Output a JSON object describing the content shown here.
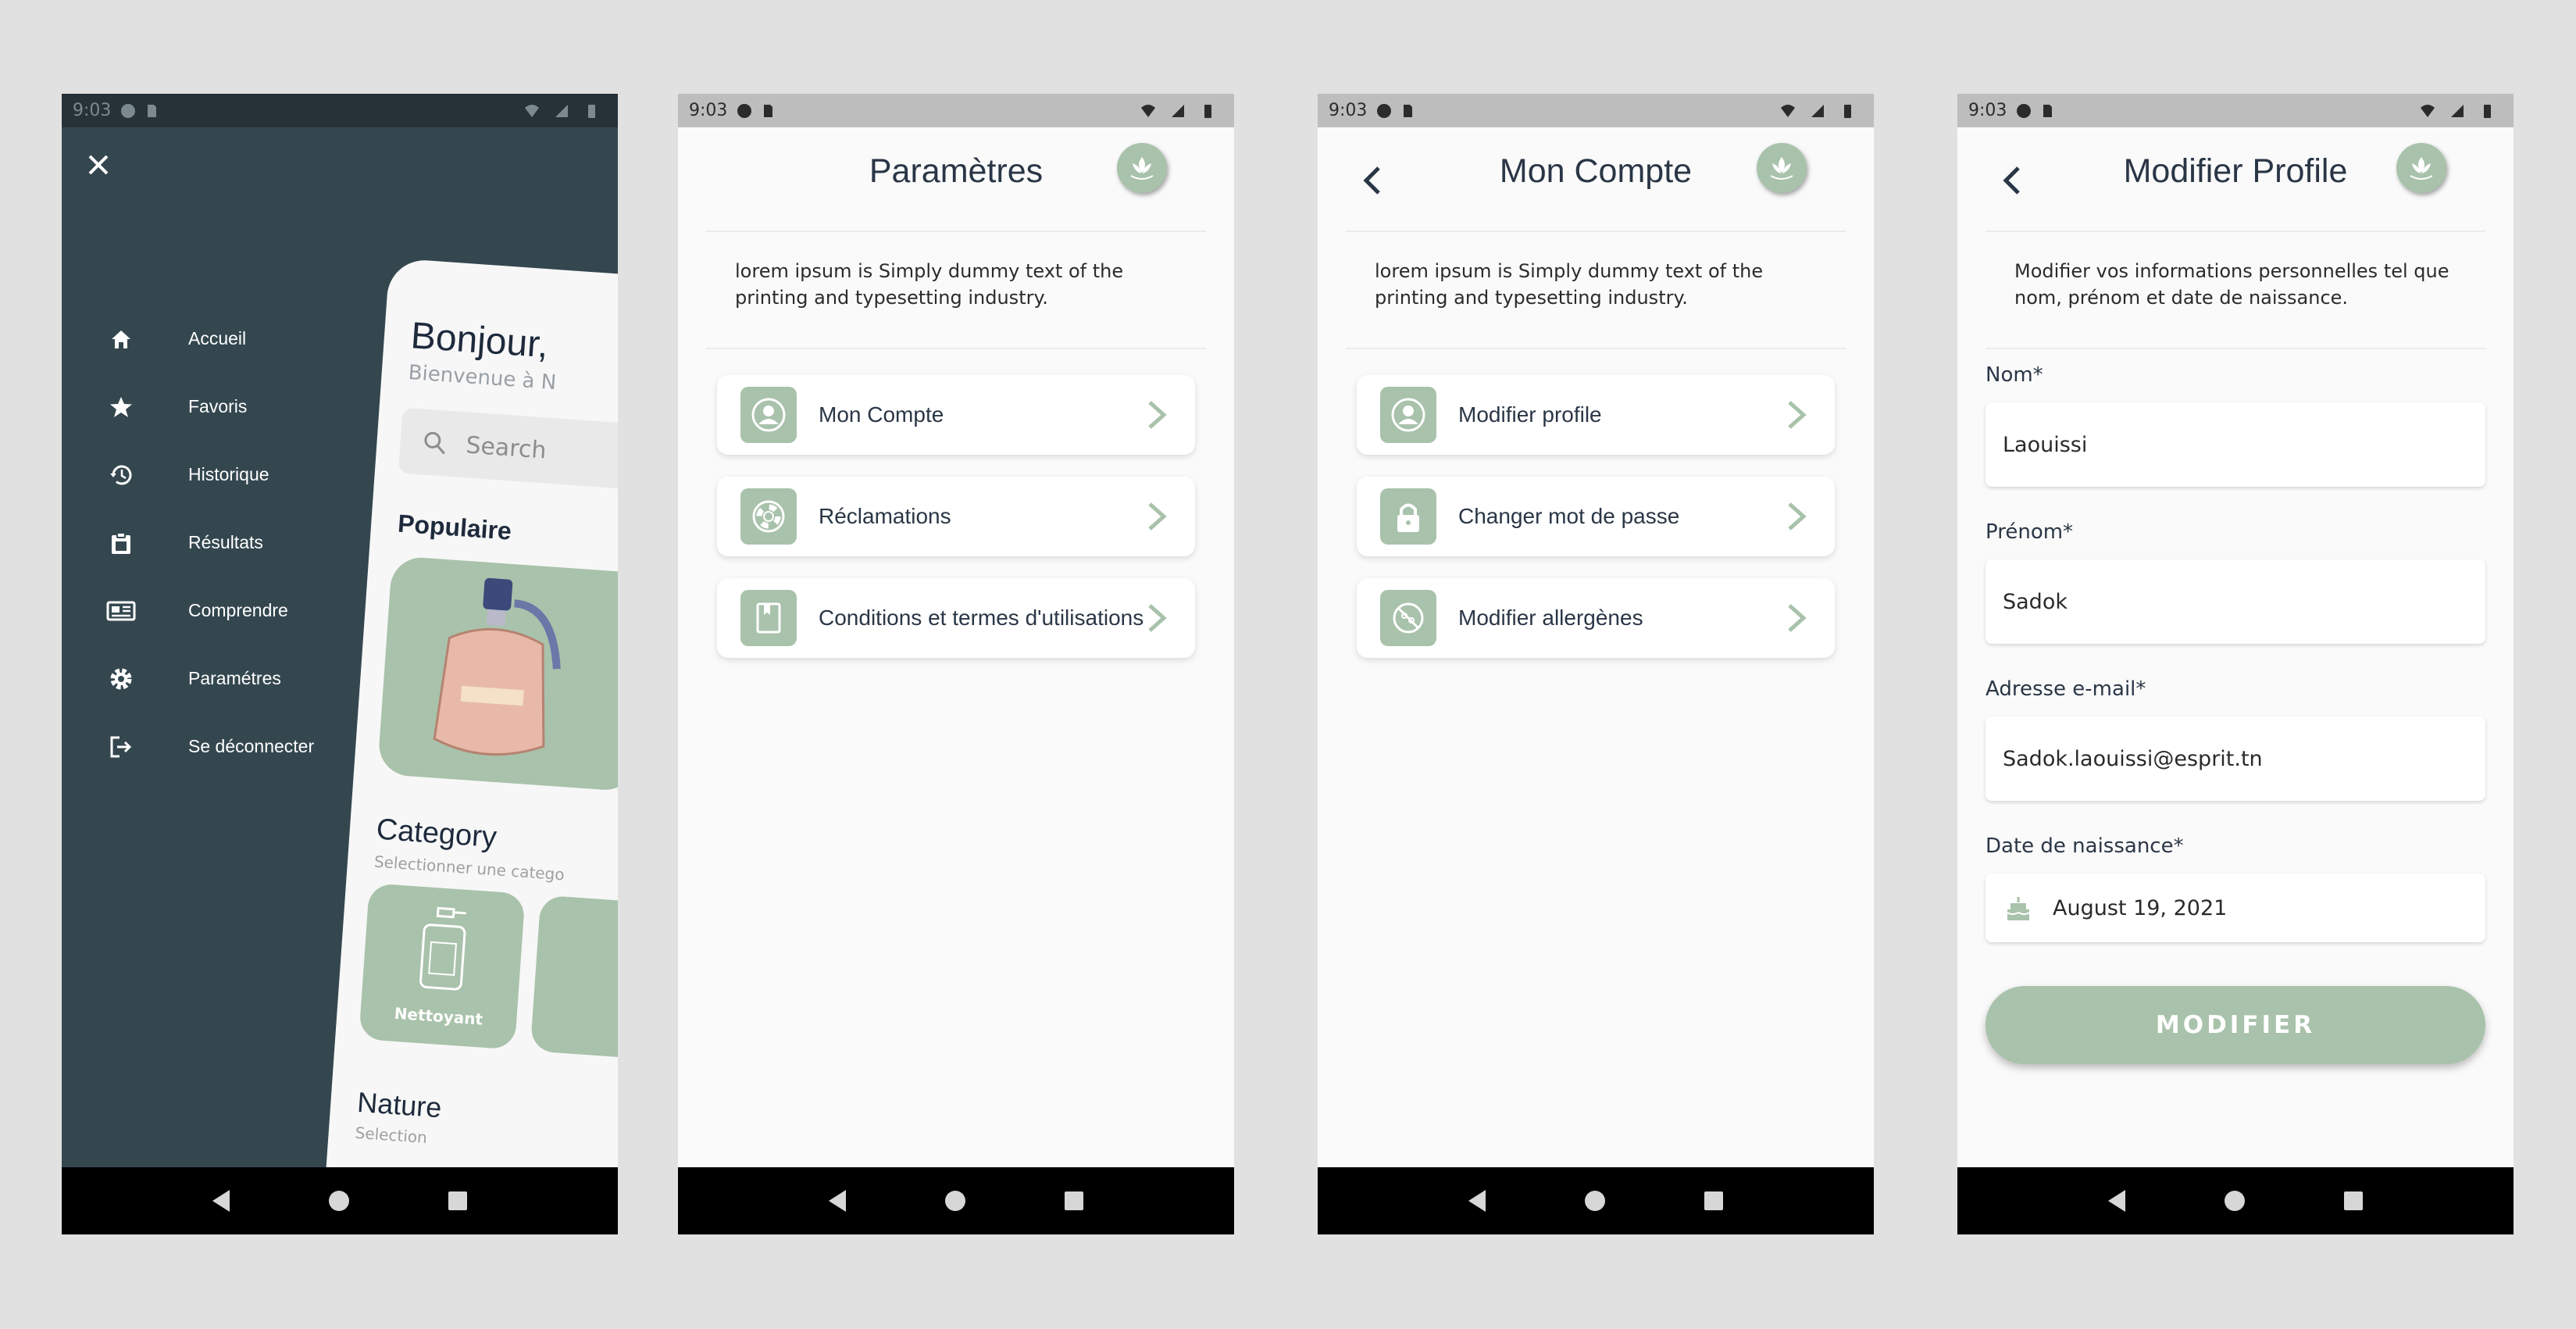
{
  "status": {
    "time": "9:03"
  },
  "drawer": {
    "items": [
      {
        "label": "Accueil",
        "icon": "home-icon"
      },
      {
        "label": "Favoris",
        "icon": "star-icon"
      },
      {
        "label": "Historique",
        "icon": "history-icon"
      },
      {
        "label": "Résultats",
        "icon": "clipboard-icon"
      },
      {
        "label": "Comprendre",
        "icon": "newspaper-icon"
      },
      {
        "label": "Paramétres",
        "icon": "gear-icon"
      },
      {
        "label": "Se déconnecter",
        "icon": "logout-icon"
      }
    ],
    "preview": {
      "greeting": "Bonjour,",
      "welcome": "Bienvenue à N",
      "search_placeholder": "Search",
      "popular": "Populaire",
      "category": "Category",
      "category_sub": "Selectionner une catego",
      "category_item": "Nettoyant",
      "nature": "Nature",
      "nature_sub": "Selection"
    }
  },
  "settings": {
    "title": "Paramètres",
    "description": "lorem ipsum is Simply dummy text of the printing and typesetting industry.",
    "items": [
      {
        "label": "Mon Compte",
        "icon": "user-icon"
      },
      {
        "label": "Réclamations",
        "icon": "lifebuoy-icon"
      },
      {
        "label": "Conditions et termes d'utilisations",
        "icon": "book-icon"
      }
    ]
  },
  "account": {
    "title": "Mon Compte",
    "description": "lorem ipsum is Simply dummy text of the printing and typesetting industry.",
    "items": [
      {
        "label": "Modifier profile",
        "icon": "user-icon"
      },
      {
        "label": "Changer mot de passe",
        "icon": "lock-icon"
      },
      {
        "label": "Modifier allergènes",
        "icon": "no-allergen-icon"
      }
    ]
  },
  "edit_profile": {
    "title": "Modifier Profile",
    "description": "Modifier vos informations personnelles tel que nom, prénom et date de naissance.",
    "fields": [
      {
        "label": "Nom*",
        "value": "Laouissi"
      },
      {
        "label": "Prénom*",
        "value": "Sadok"
      },
      {
        "label": "Adresse e-mail*",
        "value": "Sadok.laouissi@esprit.tn"
      },
      {
        "label": "Date de naissance*",
        "value": "August 19, 2021"
      }
    ],
    "submit_label": "MODIFIER"
  },
  "colors": {
    "accent": "#a9c2ab",
    "drawer_bg": "#34474f",
    "text": "#2a3646"
  }
}
